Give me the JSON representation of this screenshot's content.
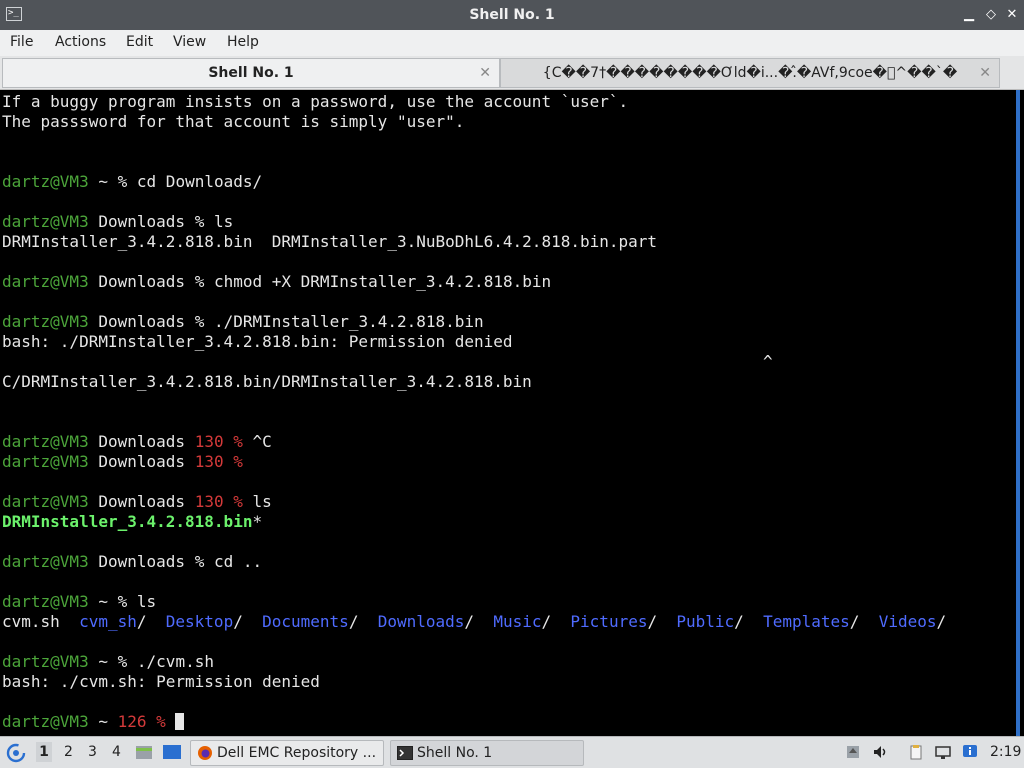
{
  "window": {
    "title": "Shell No. 1",
    "minimize_glyph": "▁",
    "restore_glyph": "◇",
    "close_glyph": "✕",
    "app_icon_glyph": ">_"
  },
  "menu": [
    "File",
    "Actions",
    "Edit",
    "View",
    "Help"
  ],
  "tabs": [
    {
      "label": "Shell No. 1",
      "close": "✕",
      "active": true
    },
    {
      "label": "{C��7†��������Ơld�i...�.̂�AVf,9coe�\u0000^��`�",
      "close": "✕",
      "active": false
    }
  ],
  "terminal": {
    "line01": "If a buggy program insists on a password, use the account `user`.",
    "line02": "The passsword for that account is simply \"user\".",
    "user_host": "dartz@VM3",
    "prompt_pct": "%",
    "home": "~",
    "downloads": "Downloads",
    "cmd_cd_downloads": "cd Downloads/",
    "cmd_ls": "ls",
    "ls_out1": "DRMInstaller_3.4.2.818.bin  DRMInstaller_3.NuBoDhL6.4.2.818.bin.part",
    "cmd_chmod": "chmod +X DRMInstaller_3.4.2.818.bin",
    "cmd_run_installer": "./DRMInstaller_3.4.2.818.bin",
    "err_installer": "bash: ./DRMInstaller_3.4.2.818.bin: Permission denied",
    "caret_mark": "^",
    "path_line": "C/DRMInstaller_3.4.2.818.bin/DRMInstaller_3.4.2.818.bin",
    "exit_130": "130",
    "ctrl_c": "^C",
    "bin_file": "DRMInstaller_3.4.2.818.bin",
    "exec_mark": "*",
    "cmd_cd_up": "cd ..",
    "home_file": "cvm.sh",
    "home_dirs": [
      "cvm_sh",
      "Desktop",
      "Documents",
      "Downloads",
      "Music",
      "Pictures",
      "Public",
      "Templates",
      "Videos"
    ],
    "dir_slash": "/",
    "cmd_run_cvm": "./cvm.sh",
    "err_cvm": "bash: ./cvm.sh: Permission denied",
    "exit_126": "126"
  },
  "taskbar": {
    "workspaces": [
      "1",
      "2",
      "3",
      "4"
    ],
    "active_workspace": "1",
    "firefox_task": "Dell EMC Repository ...",
    "shell_task": "Shell No. 1",
    "clock": "2:19"
  },
  "colors": {
    "prompt_user": "#4ca53a",
    "exit_code": "#d43a3a",
    "directory": "#4f6bff",
    "executable": "#6cf26c",
    "title_bg": "#505459",
    "accent_border": "#2f6fc7"
  }
}
